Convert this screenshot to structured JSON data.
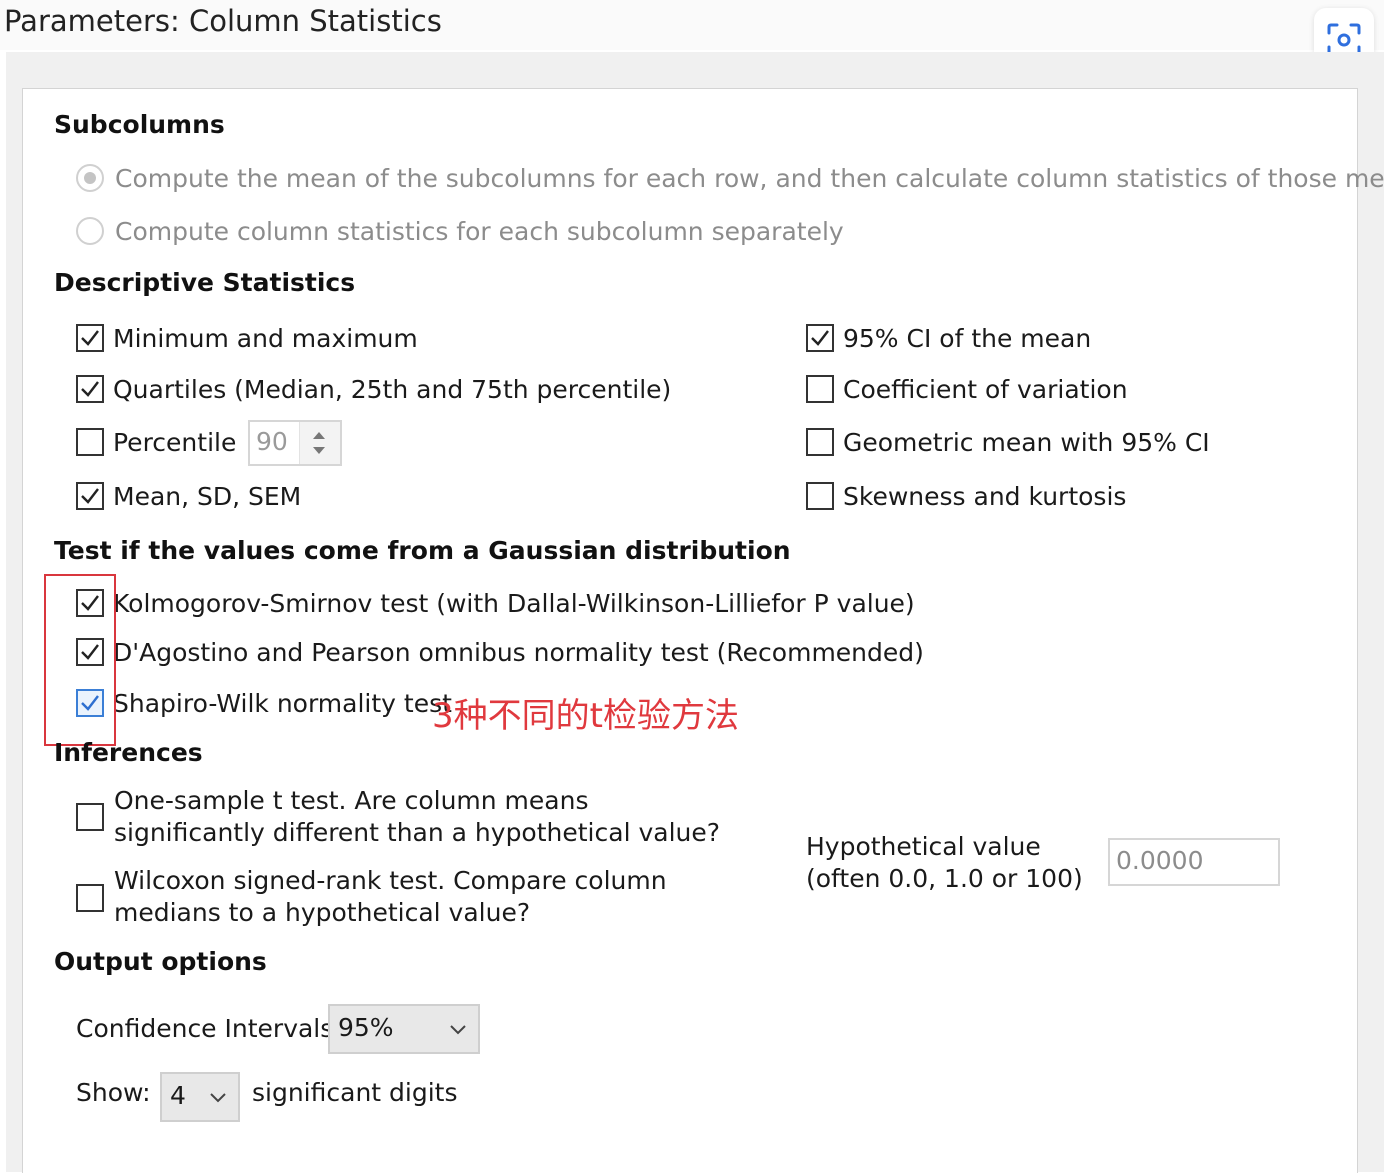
{
  "window": {
    "title": "Parameters: Column Statistics"
  },
  "subcolumns": {
    "heading": "Subcolumns",
    "options": [
      {
        "label": "Compute the mean of the subcolumns for each row, and then calculate column statistics of those means",
        "selected": true,
        "enabled": false
      },
      {
        "label": "Compute column statistics for each subcolumn separately",
        "selected": false,
        "enabled": false
      }
    ]
  },
  "descriptive": {
    "heading": "Descriptive Statistics",
    "left": [
      {
        "label": "Minimum and maximum",
        "checked": true
      },
      {
        "label": "Quartiles (Median, 25th and 75th percentile)",
        "checked": true
      },
      {
        "label": "Percentile",
        "checked": false
      },
      {
        "label": "Mean, SD, SEM",
        "checked": true
      }
    ],
    "right": [
      {
        "label": "95% CI of the mean",
        "checked": true
      },
      {
        "label": "Coefficient of variation",
        "checked": false
      },
      {
        "label": "Geometric mean with 95% CI",
        "checked": false
      },
      {
        "label": "Skewness and kurtosis",
        "checked": false
      }
    ],
    "percentile_value": "90"
  },
  "gaussian": {
    "heading": "Test if the values come from a Gaussian distribution",
    "tests": [
      {
        "label": "Kolmogorov-Smirnov test (with Dallal-Wilkinson-Lilliefor P value)",
        "checked": true
      },
      {
        "label": "D'Agostino and Pearson omnibus normality test (Recommended)",
        "checked": true
      },
      {
        "label": "Shapiro-Wilk normality test",
        "checked": true
      }
    ],
    "annotation": "3种不同的t检验方法"
  },
  "inferences": {
    "heading": "Inferences",
    "one_sample": {
      "line1": "One-sample t test. Are column means",
      "line2": "significantly different than a hypothetical value?",
      "checked": false
    },
    "wilcoxon": {
      "line1": "Wilcoxon signed-rank test. Compare column",
      "line2": "medians to a hypothetical value?",
      "checked": false
    },
    "hypothetical_label1": "Hypothetical value",
    "hypothetical_label2": "(often 0.0, 1.0 or 100)",
    "hypothetical_value": "0.0000"
  },
  "output": {
    "heading": "Output options",
    "ci_label": "Confidence Intervals:",
    "ci_value": "95%",
    "show_label": "Show:",
    "digits_value": "4",
    "digits_suffix": "significant digits"
  }
}
